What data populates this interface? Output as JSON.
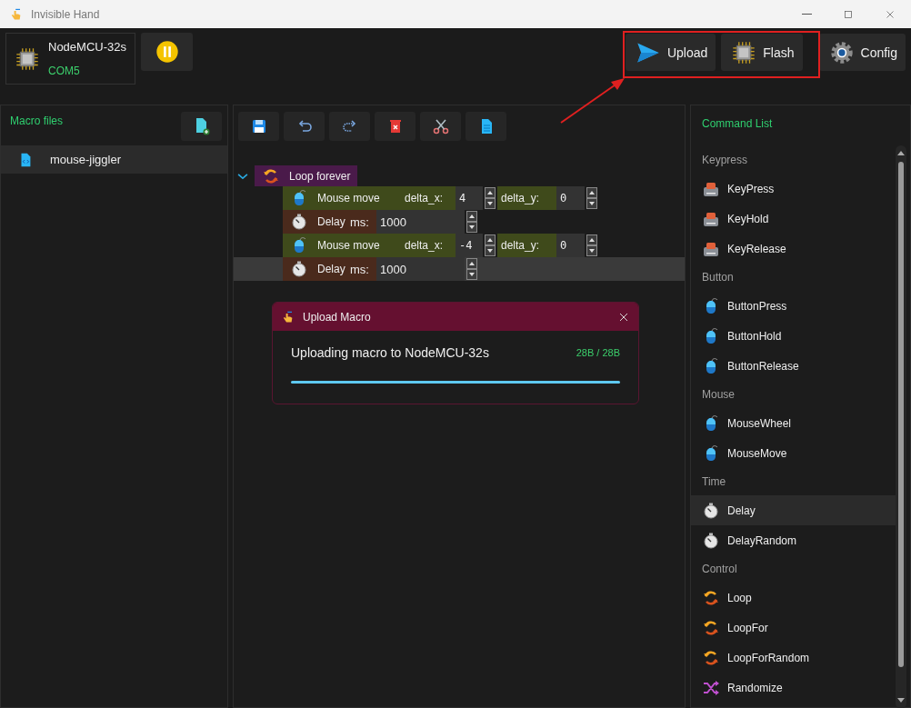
{
  "window": {
    "title": "Invisible Hand"
  },
  "device": {
    "name": "NodeMCU-32s",
    "port": "COM5"
  },
  "actions": [
    {
      "label": "Upload",
      "kind": "upload"
    },
    {
      "label": "Flash",
      "kind": "flash"
    },
    {
      "label": "Config",
      "kind": "config"
    }
  ],
  "macro_files": {
    "title": "Macro files",
    "items": [
      {
        "name": "mouse-jiggler",
        "selected": true
      }
    ]
  },
  "macro": {
    "label": "Loop forever",
    "expanded": true,
    "children": [
      {
        "kind": "mouse_move",
        "label": "Mouse move",
        "selected": false,
        "fields": [
          {
            "label": "delta_x:",
            "value": "4"
          },
          {
            "label": "delta_y:",
            "value": "0"
          }
        ]
      },
      {
        "kind": "delay",
        "label": "Delay",
        "selected": false,
        "fields": [
          {
            "label": "ms:",
            "value": "1000"
          }
        ]
      },
      {
        "kind": "mouse_move",
        "label": "Mouse move",
        "selected": false,
        "fields": [
          {
            "label": "delta_x:",
            "value": "-4"
          },
          {
            "label": "delta_y:",
            "value": "0"
          }
        ]
      },
      {
        "kind": "delay",
        "label": "Delay",
        "selected": true,
        "fields": [
          {
            "label": "ms:",
            "value": "1000"
          }
        ]
      }
    ]
  },
  "dialog": {
    "title": "Upload Macro",
    "message": "Uploading macro to NodeMCU-32s",
    "progress_text": "28B / 28B",
    "level": 1
  },
  "command_list": {
    "title": "Command List",
    "groups": [
      {
        "name": "Keypress",
        "items": [
          {
            "label": "KeyPress",
            "kind": "keyboard",
            "selected": false
          },
          {
            "label": "KeyHold",
            "kind": "keyboard",
            "selected": false
          },
          {
            "label": "KeyRelease",
            "kind": "keyboard",
            "selected": false
          }
        ]
      },
      {
        "name": "Button",
        "items": [
          {
            "label": "ButtonPress",
            "kind": "mouse",
            "selected": false
          },
          {
            "label": "ButtonHold",
            "kind": "mouse",
            "selected": false
          },
          {
            "label": "ButtonRelease",
            "kind": "mouse",
            "selected": false
          }
        ]
      },
      {
        "name": "Mouse",
        "items": [
          {
            "label": "MouseWheel",
            "kind": "mouse",
            "selected": false
          },
          {
            "label": "MouseMove",
            "kind": "mouse",
            "selected": false
          }
        ]
      },
      {
        "name": "Time",
        "items": [
          {
            "label": "Delay",
            "kind": "timer",
            "selected": true
          },
          {
            "label": "DelayRandom",
            "kind": "timer",
            "selected": false
          }
        ]
      },
      {
        "name": "Control",
        "items": [
          {
            "label": "Loop",
            "kind": "loop",
            "selected": false
          },
          {
            "label": "LoopFor",
            "kind": "loop",
            "selected": false
          },
          {
            "label": "LoopForRandom",
            "kind": "loop",
            "selected": false
          },
          {
            "label": "Randomize",
            "kind": "shuffle",
            "selected": false
          }
        ]
      }
    ]
  }
}
